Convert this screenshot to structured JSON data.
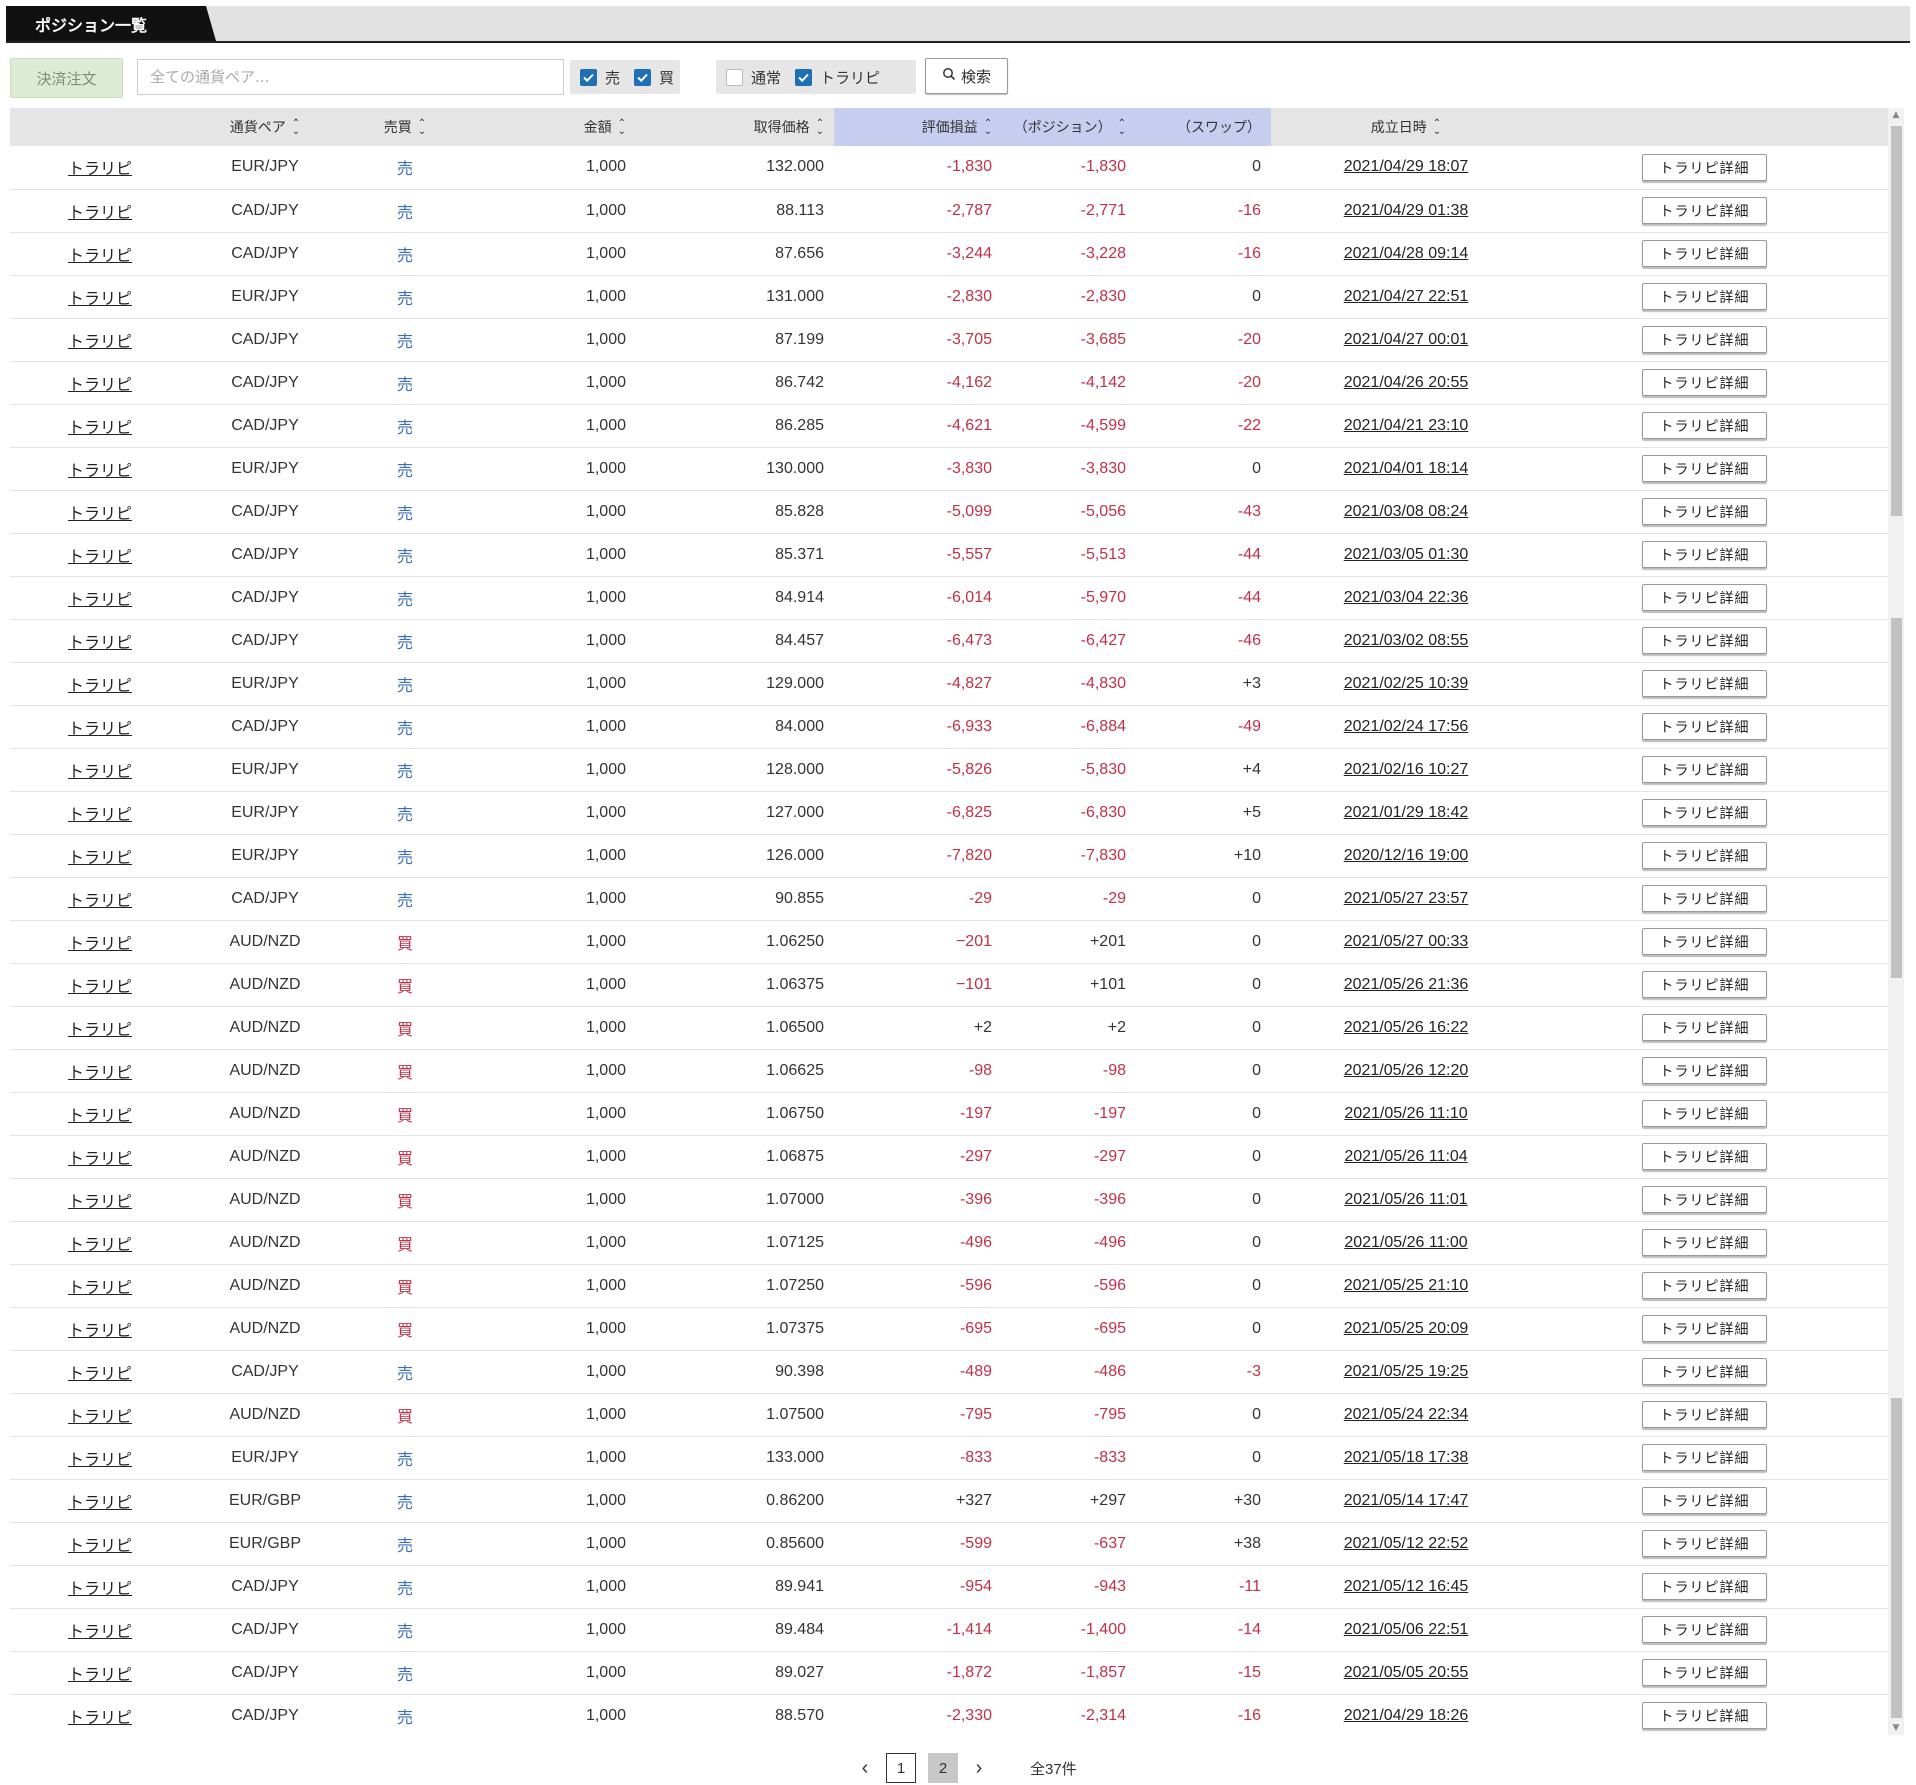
{
  "tabs": {
    "active": "ポジション一覧"
  },
  "toolbar": {
    "settle_label": "決済注文",
    "search_placeholder": "全ての通貨ペア...",
    "filter_sell": {
      "label": "売",
      "checked": true
    },
    "filter_buy": {
      "label": "買",
      "checked": true
    },
    "filter_normal": {
      "label": "通常",
      "checked": false
    },
    "filter_trarepi": {
      "label": "トラリピ",
      "checked": true
    },
    "search_label": "検索"
  },
  "table": {
    "headers": {
      "pair": "通貨ペア",
      "side": "売買",
      "amount": "金額",
      "price": "取得価格",
      "pnl": "評価損益",
      "position": "（ポジション）",
      "swap": "（スワップ）",
      "date": "成立日時"
    },
    "detail_label": "トラリピ詳細",
    "rows": [
      {
        "type": "トラリピ",
        "pair": "EUR/JPY",
        "side": "売",
        "amount": "1,000",
        "price": "132.000",
        "pnl": "-1,830",
        "position": "-1,830",
        "swap": "0",
        "date": "2021/04/29 18:07"
      },
      {
        "type": "トラリピ",
        "pair": "CAD/JPY",
        "side": "売",
        "amount": "1,000",
        "price": "88.113",
        "pnl": "-2,787",
        "position": "-2,771",
        "swap": "-16",
        "date": "2021/04/29 01:38"
      },
      {
        "type": "トラリピ",
        "pair": "CAD/JPY",
        "side": "売",
        "amount": "1,000",
        "price": "87.656",
        "pnl": "-3,244",
        "position": "-3,228",
        "swap": "-16",
        "date": "2021/04/28 09:14"
      },
      {
        "type": "トラリピ",
        "pair": "EUR/JPY",
        "side": "売",
        "amount": "1,000",
        "price": "131.000",
        "pnl": "-2,830",
        "position": "-2,830",
        "swap": "0",
        "date": "2021/04/27 22:51"
      },
      {
        "type": "トラリピ",
        "pair": "CAD/JPY",
        "side": "売",
        "amount": "1,000",
        "price": "87.199",
        "pnl": "-3,705",
        "position": "-3,685",
        "swap": "-20",
        "date": "2021/04/27 00:01"
      },
      {
        "type": "トラリピ",
        "pair": "CAD/JPY",
        "side": "売",
        "amount": "1,000",
        "price": "86.742",
        "pnl": "-4,162",
        "position": "-4,142",
        "swap": "-20",
        "date": "2021/04/26 20:55"
      },
      {
        "type": "トラリピ",
        "pair": "CAD/JPY",
        "side": "売",
        "amount": "1,000",
        "price": "86.285",
        "pnl": "-4,621",
        "position": "-4,599",
        "swap": "-22",
        "date": "2021/04/21 23:10"
      },
      {
        "type": "トラリピ",
        "pair": "EUR/JPY",
        "side": "売",
        "amount": "1,000",
        "price": "130.000",
        "pnl": "-3,830",
        "position": "-3,830",
        "swap": "0",
        "date": "2021/04/01 18:14"
      },
      {
        "type": "トラリピ",
        "pair": "CAD/JPY",
        "side": "売",
        "amount": "1,000",
        "price": "85.828",
        "pnl": "-5,099",
        "position": "-5,056",
        "swap": "-43",
        "date": "2021/03/08 08:24"
      },
      {
        "type": "トラリピ",
        "pair": "CAD/JPY",
        "side": "売",
        "amount": "1,000",
        "price": "85.371",
        "pnl": "-5,557",
        "position": "-5,513",
        "swap": "-44",
        "date": "2021/03/05 01:30"
      },
      {
        "type": "トラリピ",
        "pair": "CAD/JPY",
        "side": "売",
        "amount": "1,000",
        "price": "84.914",
        "pnl": "-6,014",
        "position": "-5,970",
        "swap": "-44",
        "date": "2021/03/04 22:36"
      },
      {
        "type": "トラリピ",
        "pair": "CAD/JPY",
        "side": "売",
        "amount": "1,000",
        "price": "84.457",
        "pnl": "-6,473",
        "position": "-6,427",
        "swap": "-46",
        "date": "2021/03/02 08:55"
      },
      {
        "type": "トラリピ",
        "pair": "EUR/JPY",
        "side": "売",
        "amount": "1,000",
        "price": "129.000",
        "pnl": "-4,827",
        "position": "-4,830",
        "swap": "+3",
        "date": "2021/02/25 10:39"
      },
      {
        "type": "トラリピ",
        "pair": "CAD/JPY",
        "side": "売",
        "amount": "1,000",
        "price": "84.000",
        "pnl": "-6,933",
        "position": "-6,884",
        "swap": "-49",
        "date": "2021/02/24 17:56"
      },
      {
        "type": "トラリピ",
        "pair": "EUR/JPY",
        "side": "売",
        "amount": "1,000",
        "price": "128.000",
        "pnl": "-5,826",
        "position": "-5,830",
        "swap": "+4",
        "date": "2021/02/16 10:27"
      },
      {
        "type": "トラリピ",
        "pair": "EUR/JPY",
        "side": "売",
        "amount": "1,000",
        "price": "127.000",
        "pnl": "-6,825",
        "position": "-6,830",
        "swap": "+5",
        "date": "2021/01/29 18:42"
      },
      {
        "type": "トラリピ",
        "pair": "EUR/JPY",
        "side": "売",
        "amount": "1,000",
        "price": "126.000",
        "pnl": "-7,820",
        "position": "-7,830",
        "swap": "+10",
        "date": "2020/12/16 19:00"
      },
      {
        "type": "トラリピ",
        "pair": "CAD/JPY",
        "side": "売",
        "amount": "1,000",
        "price": "90.855",
        "pnl": "-29",
        "position": "-29",
        "swap": "0",
        "date": "2021/05/27 23:57"
      },
      {
        "type": "トラリピ",
        "pair": "AUD/NZD",
        "side": "買",
        "amount": "1,000",
        "price": "1.06250",
        "pnl": "−201",
        "position": "+201",
        "swap": "0",
        "date": "2021/05/27 00:33"
      },
      {
        "type": "トラリピ",
        "pair": "AUD/NZD",
        "side": "買",
        "amount": "1,000",
        "price": "1.06375",
        "pnl": "−101",
        "position": "+101",
        "swap": "0",
        "date": "2021/05/26 21:36"
      },
      {
        "type": "トラリピ",
        "pair": "AUD/NZD",
        "side": "買",
        "amount": "1,000",
        "price": "1.06500",
        "pnl": "+2",
        "position": "+2",
        "swap": "0",
        "date": "2021/05/26 16:22"
      },
      {
        "type": "トラリピ",
        "pair": "AUD/NZD",
        "side": "買",
        "amount": "1,000",
        "price": "1.06625",
        "pnl": "-98",
        "position": "-98",
        "swap": "0",
        "date": "2021/05/26 12:20"
      },
      {
        "type": "トラリピ",
        "pair": "AUD/NZD",
        "side": "買",
        "amount": "1,000",
        "price": "1.06750",
        "pnl": "-197",
        "position": "-197",
        "swap": "0",
        "date": "2021/05/26 11:10"
      },
      {
        "type": "トラリピ",
        "pair": "AUD/NZD",
        "side": "買",
        "amount": "1,000",
        "price": "1.06875",
        "pnl": "-297",
        "position": "-297",
        "swap": "0",
        "date": "2021/05/26 11:04"
      },
      {
        "type": "トラリピ",
        "pair": "AUD/NZD",
        "side": "買",
        "amount": "1,000",
        "price": "1.07000",
        "pnl": "-396",
        "position": "-396",
        "swap": "0",
        "date": "2021/05/26 11:01"
      },
      {
        "type": "トラリピ",
        "pair": "AUD/NZD",
        "side": "買",
        "amount": "1,000",
        "price": "1.07125",
        "pnl": "-496",
        "position": "-496",
        "swap": "0",
        "date": "2021/05/26 11:00"
      },
      {
        "type": "トラリピ",
        "pair": "AUD/NZD",
        "side": "買",
        "amount": "1,000",
        "price": "1.07250",
        "pnl": "-596",
        "position": "-596",
        "swap": "0",
        "date": "2021/05/25 21:10"
      },
      {
        "type": "トラリピ",
        "pair": "AUD/NZD",
        "side": "買",
        "amount": "1,000",
        "price": "1.07375",
        "pnl": "-695",
        "position": "-695",
        "swap": "0",
        "date": "2021/05/25 20:09"
      },
      {
        "type": "トラリピ",
        "pair": "CAD/JPY",
        "side": "売",
        "amount": "1,000",
        "price": "90.398",
        "pnl": "-489",
        "position": "-486",
        "swap": "-3",
        "date": "2021/05/25 19:25"
      },
      {
        "type": "トラリピ",
        "pair": "AUD/NZD",
        "side": "買",
        "amount": "1,000",
        "price": "1.07500",
        "pnl": "-795",
        "position": "-795",
        "swap": "0",
        "date": "2021/05/24 22:34"
      },
      {
        "type": "トラリピ",
        "pair": "EUR/JPY",
        "side": "売",
        "amount": "1,000",
        "price": "133.000",
        "pnl": "-833",
        "position": "-833",
        "swap": "0",
        "date": "2021/05/18 17:38"
      },
      {
        "type": "トラリピ",
        "pair": "EUR/GBP",
        "side": "売",
        "amount": "1,000",
        "price": "0.86200",
        "pnl": "+327",
        "position": "+297",
        "swap": "+30",
        "date": "2021/05/14 17:47"
      },
      {
        "type": "トラリピ",
        "pair": "EUR/GBP",
        "side": "売",
        "amount": "1,000",
        "price": "0.85600",
        "pnl": "-599",
        "position": "-637",
        "swap": "+38",
        "date": "2021/05/12 22:52"
      },
      {
        "type": "トラリピ",
        "pair": "CAD/JPY",
        "side": "売",
        "amount": "1,000",
        "price": "89.941",
        "pnl": "-954",
        "position": "-943",
        "swap": "-11",
        "date": "2021/05/12 16:45"
      },
      {
        "type": "トラリピ",
        "pair": "CAD/JPY",
        "side": "売",
        "amount": "1,000",
        "price": "89.484",
        "pnl": "-1,414",
        "position": "-1,400",
        "swap": "-14",
        "date": "2021/05/06 22:51"
      },
      {
        "type": "トラリピ",
        "pair": "CAD/JPY",
        "side": "売",
        "amount": "1,000",
        "price": "89.027",
        "pnl": "-1,872",
        "position": "-1,857",
        "swap": "-15",
        "date": "2021/05/05 20:55"
      },
      {
        "type": "トラリピ",
        "pair": "CAD/JPY",
        "side": "売",
        "amount": "1,000",
        "price": "88.570",
        "pnl": "-2,330",
        "position": "-2,314",
        "swap": "-16",
        "date": "2021/04/29 18:26"
      }
    ]
  },
  "pagination": {
    "prev_icon": "chevron-left-icon",
    "next_icon": "chevron-right-icon",
    "pages": [
      "1",
      "2"
    ],
    "current": "1",
    "total_label": "全37件"
  },
  "colors": {
    "sell": "#3b6eb5",
    "buy": "#c0304a",
    "negative": "#c0304a",
    "header_highlight": "#c6cdee",
    "settle_button": "#dcebd3",
    "checkbox": "#1f6fb5"
  }
}
